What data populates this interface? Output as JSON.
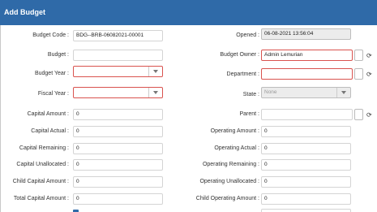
{
  "header": {
    "title": "Add Budget"
  },
  "left": {
    "budget_code": {
      "label": "Budget Code :",
      "value": "BDG--BRB-06082021-00001"
    },
    "budget": {
      "label": "Budget :",
      "value": ""
    },
    "budget_year": {
      "label": "Budget Year :",
      "value": ""
    },
    "fiscal_year": {
      "label": "Fiscal Year :",
      "value": ""
    },
    "capital_amount": {
      "label": "Capital Amount :",
      "value": "0"
    },
    "capital_actual": {
      "label": "Capital Actual :",
      "value": "0"
    },
    "capital_remaining": {
      "label": "Capital Remaining :",
      "value": "0"
    },
    "capital_unallocated": {
      "label": "Capital Unallocated :",
      "value": "0"
    },
    "child_capital_amount": {
      "label": "Child Capital Amount :",
      "value": "0"
    },
    "total_capital_amount": {
      "label": "Total Capital Amount :",
      "value": "0"
    }
  },
  "right": {
    "opened": {
      "label": "Opened :",
      "value": "06-08-2021 13:56:04"
    },
    "budget_owner": {
      "label": "Budget Owner :",
      "value": "Admin Lemurian"
    },
    "department": {
      "label": "Department :",
      "value": ""
    },
    "state": {
      "label": "State :",
      "value": "None"
    },
    "parent": {
      "label": "Parent :",
      "value": ""
    },
    "operating_amount": {
      "label": "Operating Amount :",
      "value": "0"
    },
    "operating_actual": {
      "label": "Operating Actual :",
      "value": "0"
    },
    "operating_remaining": {
      "label": "Operating Remaining :",
      "value": "0"
    },
    "operating_unallocated": {
      "label": "Operating Unallocated :",
      "value": "0"
    },
    "child_operating_amount": {
      "label": "Child Operating Amount :",
      "value": "0"
    }
  },
  "icons": {
    "refresh": "refresh-icon",
    "dropdown": "chevron-down-icon"
  },
  "colors": {
    "header_bg": "#2f6aa8",
    "error_border": "#d9534f"
  }
}
